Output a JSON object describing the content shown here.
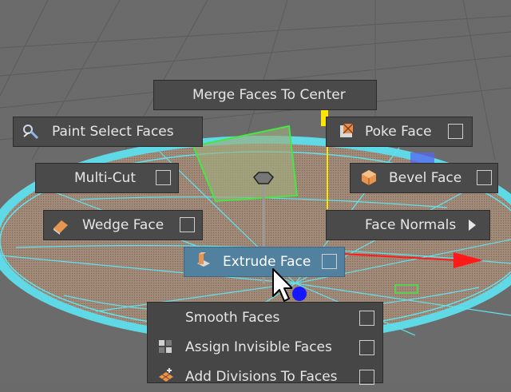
{
  "marking_menu": {
    "north": {
      "label": "Merge Faces To Center"
    },
    "north_west": {
      "label": "Paint Select Faces",
      "icon": "paint-select-icon"
    },
    "north_east": {
      "label": "Poke Face",
      "icon": "poke-face-icon"
    },
    "west_upper": {
      "label": "Multi-Cut"
    },
    "east_upper": {
      "label": "Bevel Face",
      "icon": "bevel-face-icon"
    },
    "west": {
      "label": "Wedge Face",
      "icon": "wedge-face-icon"
    },
    "east": {
      "label": "Face Normals"
    },
    "south": {
      "label": "Extrude Face",
      "icon": "extrude-face-icon",
      "active": true
    }
  },
  "bottom_menu": {
    "items": [
      {
        "label": "Smooth Faces"
      },
      {
        "label": "Assign Invisible Faces",
        "icon": "invisible-faces-icon"
      },
      {
        "label": "Add Divisions To Faces",
        "icon": "add-divisions-icon"
      }
    ]
  },
  "colors": {
    "background": "#6a6a6a",
    "mesh_fill": "#a88f7e",
    "wireframe": "#5fe3f0",
    "selected_face": "#43e843",
    "menu_bg": "#4a4a4a",
    "active_bg": "#52809f",
    "axis_red": "#ff1a1a",
    "axis_blue": "#1717ff",
    "axis_yellow": "#ffe600"
  }
}
